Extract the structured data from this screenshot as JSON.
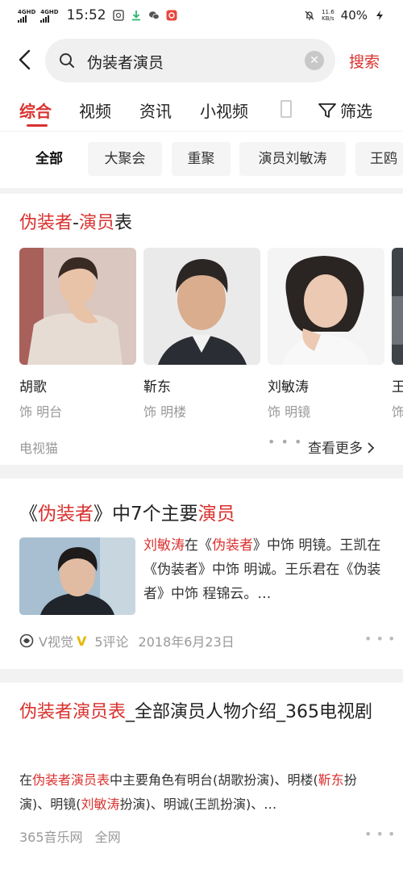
{
  "status": {
    "net1": "4GHD",
    "net2": "4GHD",
    "time": "15:52",
    "speed_value": "11.6",
    "speed_unit": "KB/s",
    "battery": "40%"
  },
  "search": {
    "query": "伪装者演员",
    "button": "搜索"
  },
  "tabs": [
    {
      "label": "综合"
    },
    {
      "label": "视频"
    },
    {
      "label": "资讯"
    },
    {
      "label": "小视频"
    }
  ],
  "filter_label": "筛选",
  "chips": [
    {
      "label": "全部"
    },
    {
      "label": "大聚会"
    },
    {
      "label": "重聚"
    },
    {
      "label": "演员刘敏涛"
    },
    {
      "label": "王鸥"
    }
  ],
  "cast_card": {
    "title_a": "伪装者",
    "title_sep": "-",
    "title_b": "演员",
    "title_c": "表",
    "actors": [
      {
        "name": "胡歌",
        "role": "饰 明台"
      },
      {
        "name": "靳东",
        "role": "饰 明楼"
      },
      {
        "name": "刘敏涛",
        "role": "饰 明镜"
      },
      {
        "name": "王",
        "role": "饰"
      }
    ],
    "source": "电视猫",
    "more": "查看更多"
  },
  "article": {
    "title_a": "《",
    "title_b": "伪装者",
    "title_c": "》中7个主要",
    "title_d": "演员",
    "snip_1": "刘敏涛",
    "snip_2": "在《",
    "snip_3": "伪装者",
    "snip_4": "》中饰 明镜。王凯在《伪装者》中饰 明诚。王乐君在《伪装者》中饰 程锦云。…",
    "source": "V视觉",
    "comments": "5评论",
    "date": "2018年6月23日"
  },
  "result": {
    "title_a": "伪装者演员表",
    "title_b": "_全部演员人物介绍_365电视剧",
    "s1": "在",
    "s2": "伪装者演员表",
    "s3": "中主要角色有明台(胡歌扮演)、明楼(",
    "s4": "靳东",
    "s5": "扮演)、明镜(",
    "s6": "刘敏涛",
    "s7": "扮演)、明诚(王凯扮演)、…",
    "source": "365音乐网",
    "scope": "全网"
  },
  "colors": {
    "accent": "#d9322f",
    "muted": "#999999"
  }
}
